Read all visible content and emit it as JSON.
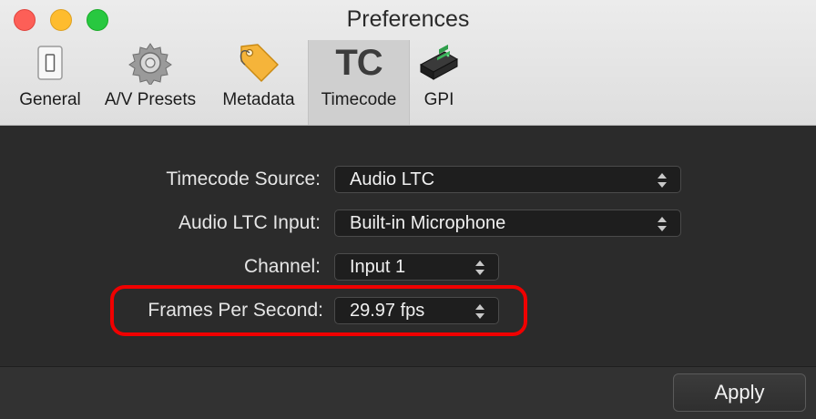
{
  "window": {
    "title": "Preferences"
  },
  "toolbar": {
    "tabs": [
      {
        "label": "General",
        "icon": "switch-icon"
      },
      {
        "label": "A/V Presets",
        "icon": "gear-icon"
      },
      {
        "label": "Metadata",
        "icon": "tag-icon"
      },
      {
        "label": "Timecode",
        "icon": "tc-icon",
        "glyph": "TC",
        "selected": true
      },
      {
        "label": "GPI",
        "icon": "gpi-device-icon"
      }
    ]
  },
  "form": {
    "timecode_source": {
      "label": "Timecode Source:",
      "value": "Audio LTC"
    },
    "audio_ltc_input": {
      "label": "Audio LTC Input:",
      "value": "Built-in Microphone"
    },
    "channel": {
      "label": "Channel:",
      "value": "Input 1"
    },
    "fps": {
      "label": "Frames Per Second:",
      "value": "29.97 fps"
    }
  },
  "footer": {
    "apply_label": "Apply"
  },
  "colors": {
    "highlight": "#f00000",
    "content_bg": "#2b2b2b",
    "toolbar_bg": "#e6e6e6"
  }
}
